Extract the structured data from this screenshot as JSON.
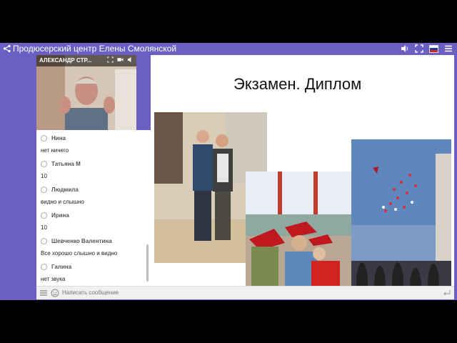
{
  "header": {
    "title": "Продюсерский центр Елены Смолянской",
    "icons": [
      "share-icon",
      "volume-icon",
      "fullscreen-icon",
      "russian-flag-icon",
      "menu-icon"
    ]
  },
  "video": {
    "name": "АЛЕКСАНДР СТР..."
  },
  "chat": {
    "messages": [
      {
        "author": "Нина",
        "text": "нет ничего"
      },
      {
        "author": "Татьяна М",
        "text": "10"
      },
      {
        "author": "Людмила",
        "text": "видно и слышно"
      },
      {
        "author": "Ирина",
        "text": "10"
      },
      {
        "author": "Шевченко Валентина",
        "text": "Все хорошо слышно и видно"
      },
      {
        "author": "Галина",
        "text": "нет звука"
      }
    ],
    "input_placeholder": "Написать сообщение"
  },
  "slide": {
    "title": "Экзамен. Диплом"
  },
  "colors": {
    "frame": "#6b5fc4",
    "accent_red": "#c0181f"
  }
}
